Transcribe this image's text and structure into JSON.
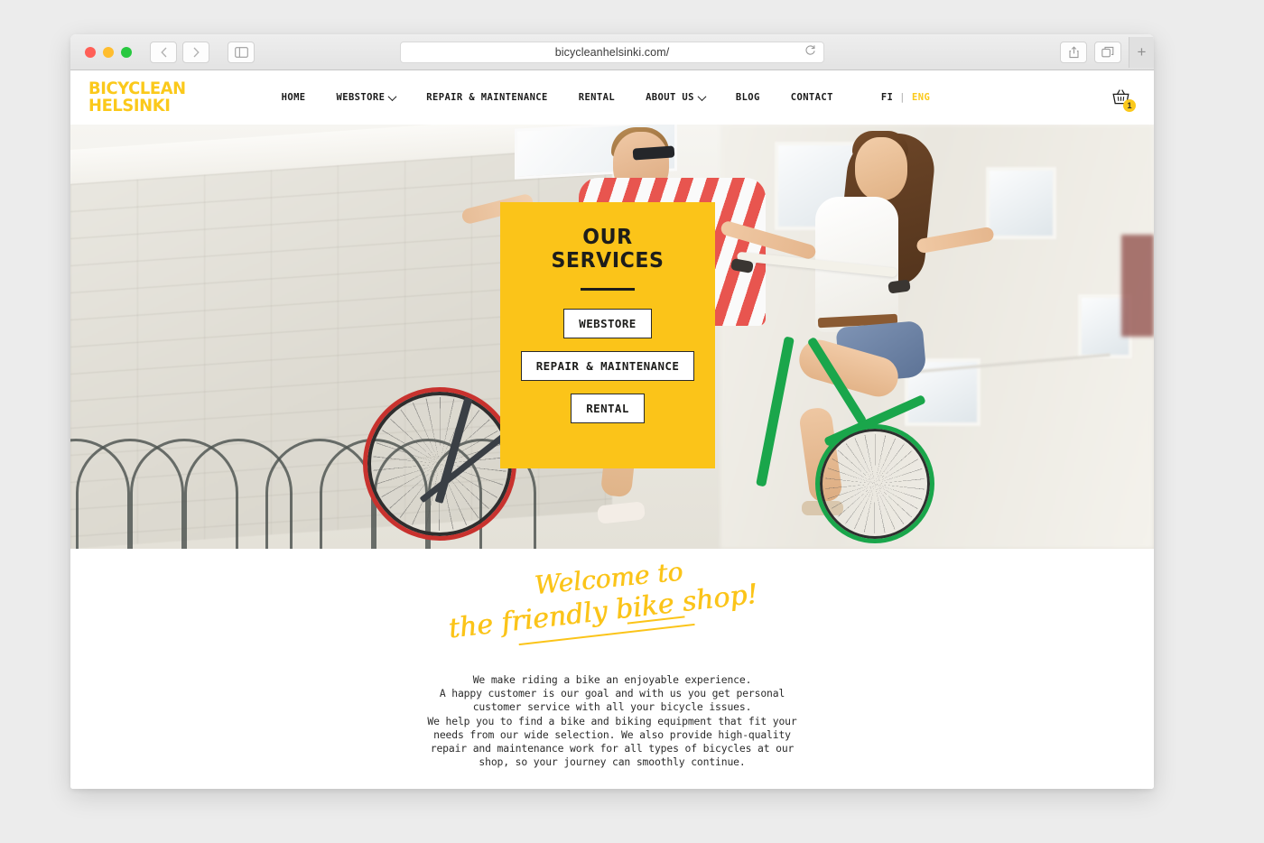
{
  "browser": {
    "url": "bicycleanhelsinki.com/",
    "back_icon": "chevron-left-icon",
    "forward_icon": "chevron-right-icon",
    "sidebar_icon": "sidebar-toggle-icon",
    "reload_icon": "reload-icon",
    "share_icon": "share-icon",
    "tabs_icon": "tab-overview-icon",
    "new_tab_label": "+"
  },
  "header": {
    "logo_line1": "BICYCLEAN",
    "logo_line2": "HELSINKI",
    "nav": [
      {
        "label": "HOME",
        "has_dropdown": false
      },
      {
        "label": "WEBSTORE",
        "has_dropdown": true
      },
      {
        "label": "REPAIR & MAINTENANCE",
        "has_dropdown": false
      },
      {
        "label": "RENTAL",
        "has_dropdown": false
      },
      {
        "label": "ABOUT US",
        "has_dropdown": true
      },
      {
        "label": "BLOG",
        "has_dropdown": false
      },
      {
        "label": "CONTACT",
        "has_dropdown": false
      }
    ],
    "lang": {
      "inactive": "FI",
      "separator": "|",
      "active": "ENG"
    },
    "cart": {
      "icon": "shopping-basket-icon",
      "count": "1"
    }
  },
  "hero": {
    "services_card": {
      "title_line1": "OUR",
      "title_line2": "SERVICES",
      "buttons": [
        {
          "label": "WEBSTORE"
        },
        {
          "label": "REPAIR & MAINTENANCE"
        },
        {
          "label": "RENTAL"
        }
      ]
    }
  },
  "welcome": {
    "script_line1": "Welcome to",
    "script_line2": "the friendly bike shop!",
    "paragraph_lines": [
      "We make riding a bike an enjoyable experience.",
      "A happy customer is our goal and with us you get personal",
      "customer service with all your bicycle issues.",
      "We help you to find a bike and biking equipment that fit your",
      "needs from our wide selection. We also provide high-quality",
      "repair and maintenance work for all types of bicycles at our",
      "shop, so your journey can smoothly continue."
    ]
  },
  "colors": {
    "brand_yellow": "#fbc419",
    "text_dark": "#1d1d1b"
  }
}
